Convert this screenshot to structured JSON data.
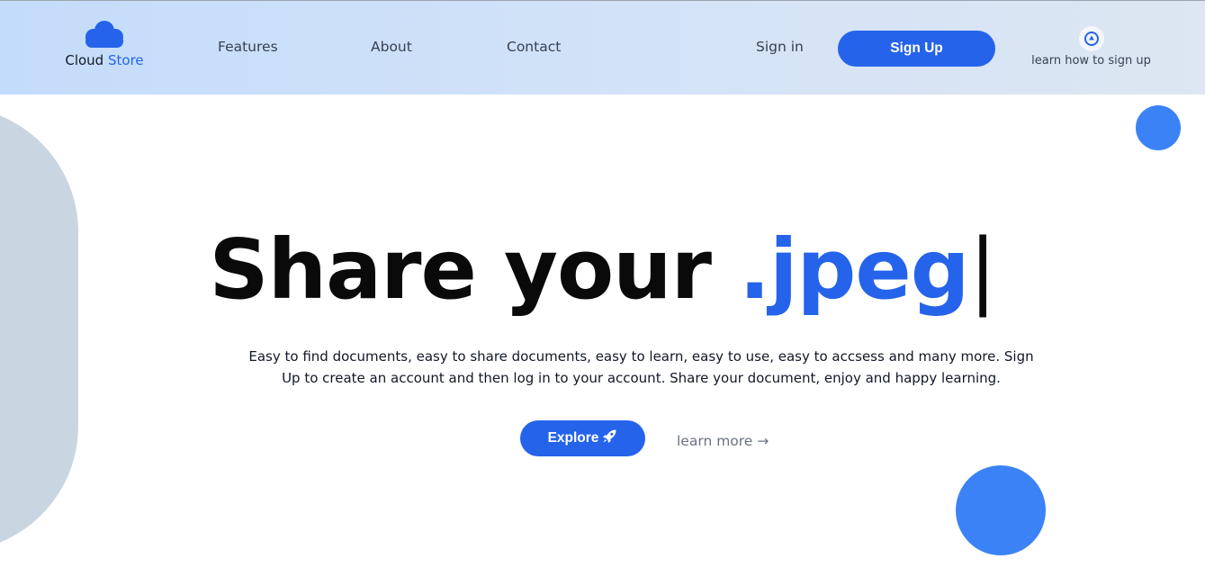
{
  "brand": {
    "name_part1": "Cloud",
    "name_part2": "Store"
  },
  "nav": {
    "features": "Features",
    "about": "About",
    "contact": "Contact",
    "sign_in": "Sign in",
    "sign_up": "Sign Up",
    "how_to": "learn how to sign up"
  },
  "hero": {
    "title_prefix": "Share your ",
    "title_extension": ".jpeg",
    "caret": "|",
    "description": "Easy to find documents, easy to share documents, easy to learn, easy to use, easy to accsess and many more. Sign Up to create an account and then log in to your account. Share your document, enjoy and happy learning.",
    "explore_label": "Explore",
    "learn_more_label": "learn more →"
  },
  "colors": {
    "accent": "#2563eb",
    "circle": "#3b82f6",
    "blob": "#c9d6e2"
  },
  "icons": {
    "logo": "cloud-icon",
    "how_to": "up-arrow-circle-icon",
    "explore": "rocket-icon"
  }
}
